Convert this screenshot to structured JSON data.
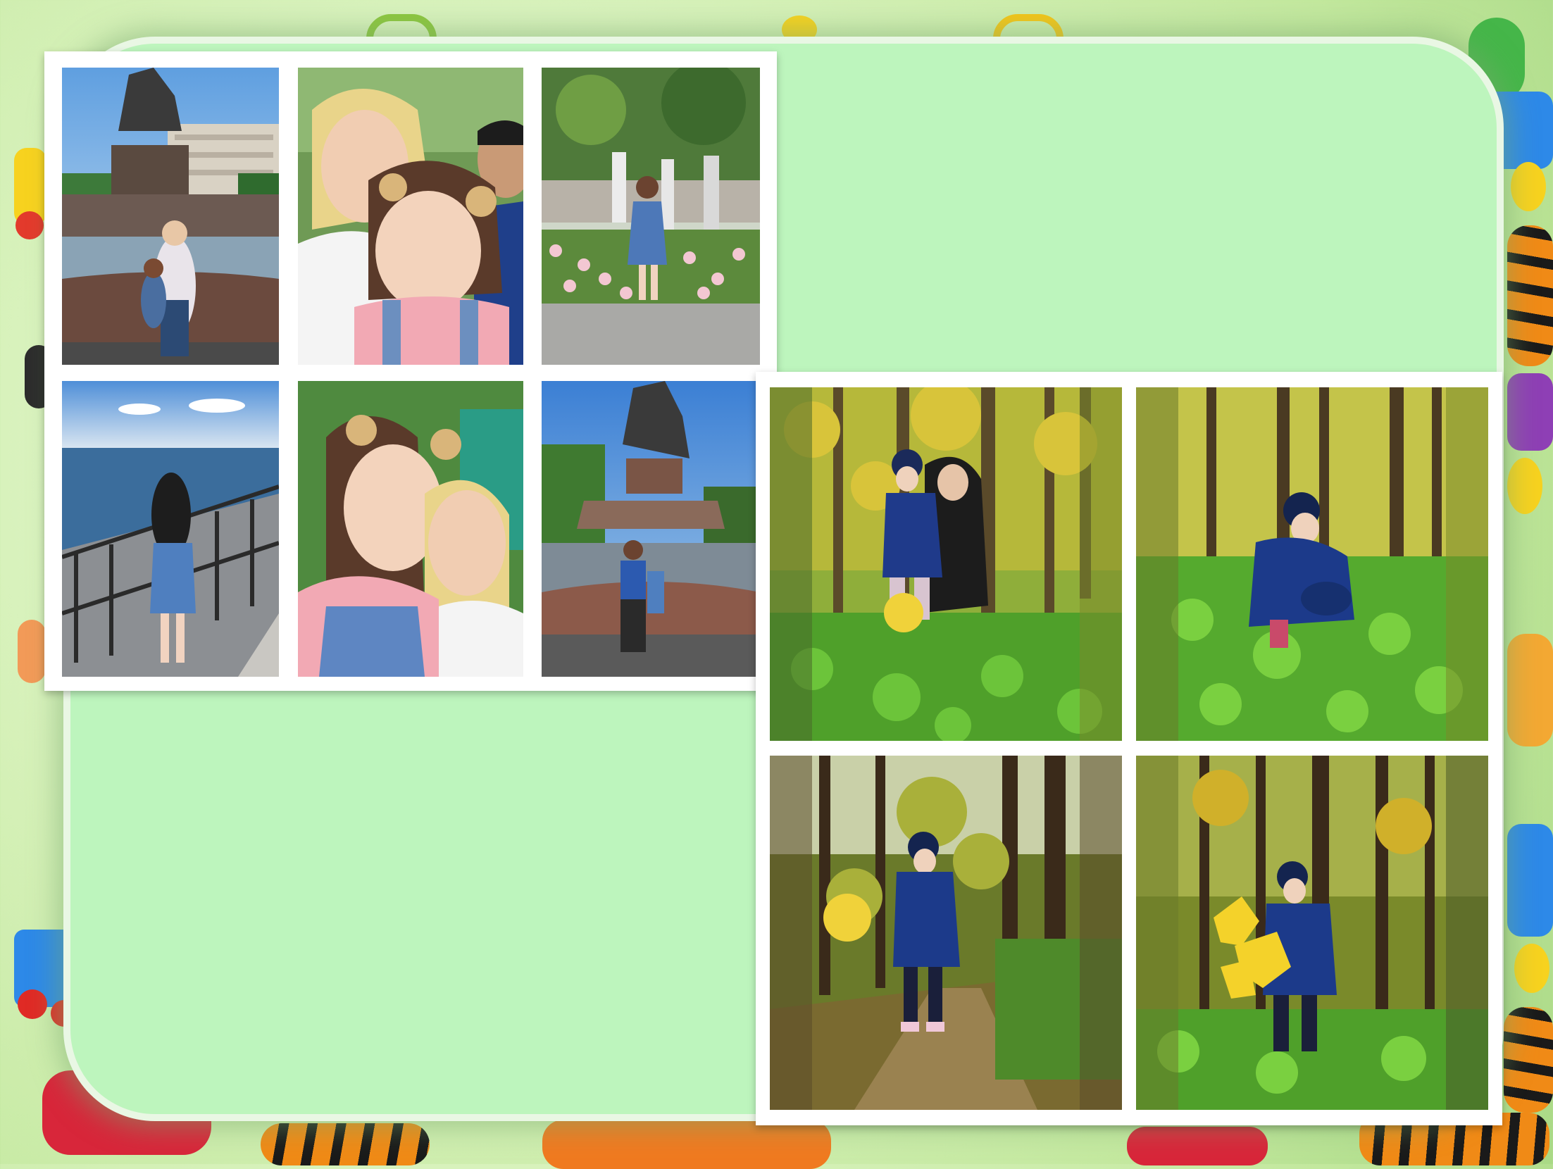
{
  "slide": {
    "background_color": "#cdeeb0",
    "frame_color": "#bdf5bd"
  },
  "collage_summer": {
    "photos": [
      {
        "name": "photo-fountain-mother-daughter"
      },
      {
        "name": "photo-selfie-family"
      },
      {
        "name": "photo-girl-rose-garden"
      },
      {
        "name": "photo-girl-embankment"
      },
      {
        "name": "photo-selfie-mother-daughter"
      },
      {
        "name": "photo-fountain-father-daughter"
      }
    ]
  },
  "collage_autumn": {
    "photos": [
      {
        "name": "photo-forest-mother-daughter"
      },
      {
        "name": "photo-forest-girl-crouching"
      },
      {
        "name": "photo-forest-girl-path"
      },
      {
        "name": "photo-forest-girl-leaves"
      }
    ]
  }
}
